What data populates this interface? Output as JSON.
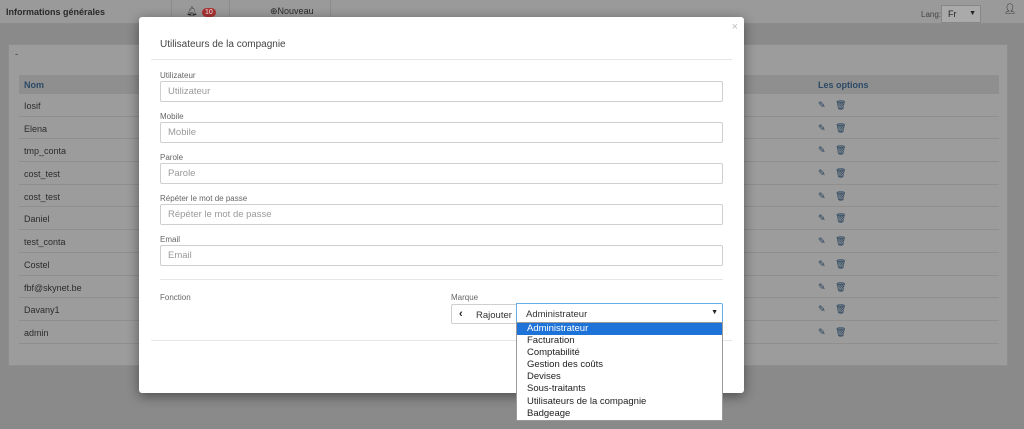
{
  "topbar": {
    "title": "Informations générales",
    "bell_icon": "bell-icon",
    "notif_count": "10",
    "new_label": "Nouveau",
    "lang_label": "Lang:",
    "lang_value": "Fr",
    "user_icon": "user-icon"
  },
  "panel": {
    "dash": "-",
    "headers": {
      "name": "Nom",
      "options": "Les options"
    },
    "rows": [
      "Iosif",
      "Elena",
      "tmp_conta",
      "cost_test",
      "cost_test",
      "Daniel",
      "test_conta",
      "Costel",
      "fbf@skynet.be",
      "Davany1",
      "admin"
    ]
  },
  "modal": {
    "title": "Utilisateurs de la compagnie",
    "close": "×",
    "fields": {
      "user_label": "Utilizateur",
      "user_placeholder": "Utilizateur",
      "mobile_label": "Mobile",
      "mobile_placeholder": "Mobile",
      "parole_label": "Parole",
      "parole_placeholder": "Parole",
      "repeat_label": "Répéter le mot de passe",
      "repeat_placeholder": "Répéter le mot de passe",
      "email_label": "Email",
      "email_placeholder": "Email"
    },
    "fonction_label": "Fonction",
    "marque_label": "Marque",
    "rajouter_label": "Rajouter",
    "select_value": "Administrateur",
    "options": [
      "Administrateur",
      "Facturation",
      "Comptabilité",
      "Gestion des coûts",
      "Devises",
      "Sous-traitants",
      "Utilisateurs de la compagnie",
      "Badgeage"
    ]
  },
  "colors": {
    "accent": "#1e73d8",
    "header_text": "#2c4a66"
  }
}
